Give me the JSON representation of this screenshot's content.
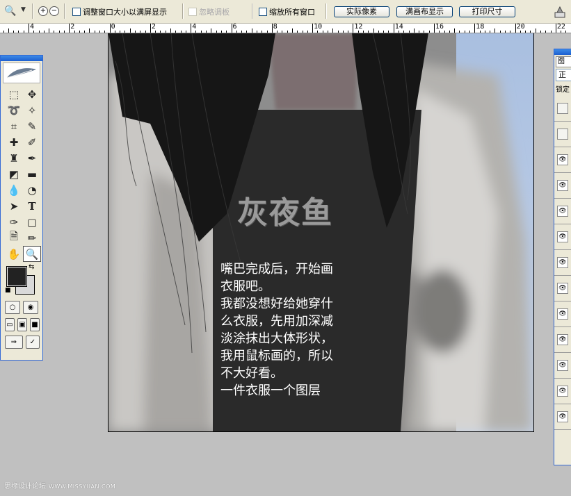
{
  "options_bar": {
    "resize_windows_label": "调整窗口大小以满屏显示",
    "ignore_palettes_label": "忽略调板",
    "zoom_all_windows_label": "缩放所有窗口",
    "actual_pixels_label": "实际像素",
    "fit_screen_label": "满画布显示",
    "print_size_label": "打印尺寸"
  },
  "ruler": {
    "labels": [
      "4",
      "2",
      "0",
      "2",
      "4",
      "6",
      "8",
      "10",
      "12",
      "14",
      "16",
      "18",
      "20",
      "22"
    ]
  },
  "canvas": {
    "logo_text": "灰夜鱼",
    "caption": "嘴巴完成后，开始画\n衣服吧。\n我都没想好给她穿什\n么衣服，先用加深减\n淡涂抹出大体形状，\n我用鼠标画的，所以\n不大好看。\n一件衣服一个图层"
  },
  "layers_panel": {
    "tab_label": "图",
    "blend_mode": "正",
    "lock_label": "锁定",
    "layer_visibility": [
      false,
      false,
      true,
      true,
      true,
      true,
      true,
      true,
      true,
      true,
      true,
      true,
      true
    ]
  },
  "watermark": {
    "site_name": "思缘设计论坛",
    "url": "WWW.MISSYUAN.COM"
  },
  "colors": {
    "foreground": "#222222",
    "background": "#d9d9d9",
    "canvas_bg": "#c0c0c0",
    "sky": "#b8cbe6"
  }
}
